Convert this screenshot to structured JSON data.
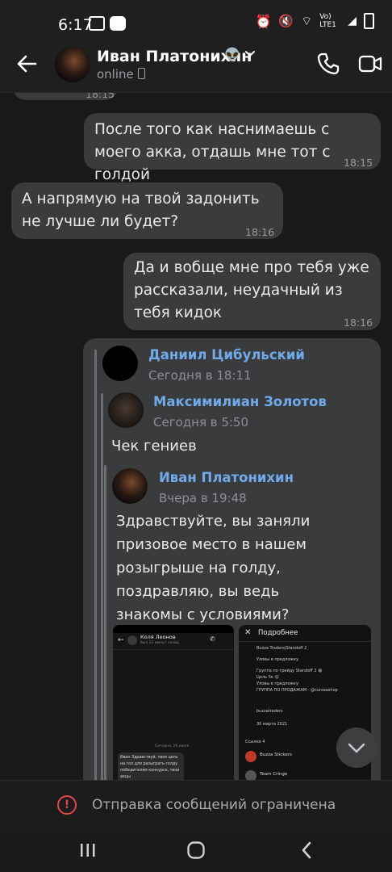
{
  "status_bar": {
    "time": "6:17",
    "network": "Vo) LTE1"
  },
  "header": {
    "name": "Иван Платонихин",
    "emoji": "👽",
    "status": "online",
    "icons": [
      "back-arrow-icon",
      "phone-icon",
      "video-icon"
    ]
  },
  "messages": [
    {
      "time": "18:15",
      "text": "",
      "outgoing": false
    },
    {
      "text": "После того как наснимаешь с моего акка, отдашь мне тот с голдой",
      "time": "18:15",
      "outgoing": true
    },
    {
      "text": "А напрямую на твой задонить не лучше ли будет?",
      "time": "18:16",
      "outgoing": false
    },
    {
      "text": "Да и вобще мне про тебя уже рассказали, неудачный из тебя кидок",
      "time": "18:16",
      "outgoing": true
    }
  ],
  "forwarded": {
    "level1": {
      "name": "Даниил Цибульский",
      "date": "Сегодня в 18:11"
    },
    "level2": {
      "name": "Максимилиан Золотов",
      "date": "Сегодня в 5:50",
      "text": "Чек гениев"
    },
    "level3": {
      "name": "Иван Платонихин",
      "date": "Вчера в 19:48",
      "text": "Здравствуйте, вы заняли призовое место в нашем розыгрыше на голду, поздравляю, вы ведь знакомы с условиями?"
    },
    "screenshot_left": {
      "name": "Коля Леонов",
      "sub": "был 12 минут назад",
      "date": "Сегодня, 26 июля",
      "msg": "Иван Здравствуй, твоя цель на гол для разыграть голду победителям конкурсе, твои акцы"
    },
    "screenshot_right": {
      "title": "Подробнее",
      "lines": [
        "Buzza Traders|Standoff 2",
        "Уловы в предложку",
        "Группа по трейду Standoff 2 😀",
        "Цель 5к 😊",
        "Уловы в предложку",
        "ГРУППА ПО ПРОДАЖАМ - @curzaashop",
        "buzzatraders",
        "30 марта 2021",
        "Ссылки 4",
        "Buzza Stickers",
        "Team Cringe"
      ]
    }
  },
  "restriction": {
    "text": "Отправка сообщений ограничена"
  },
  "colors": {
    "accent": "#71aaeb",
    "bubble": "#3a3b3c",
    "background": "#19191a",
    "warn": "#e64646"
  }
}
